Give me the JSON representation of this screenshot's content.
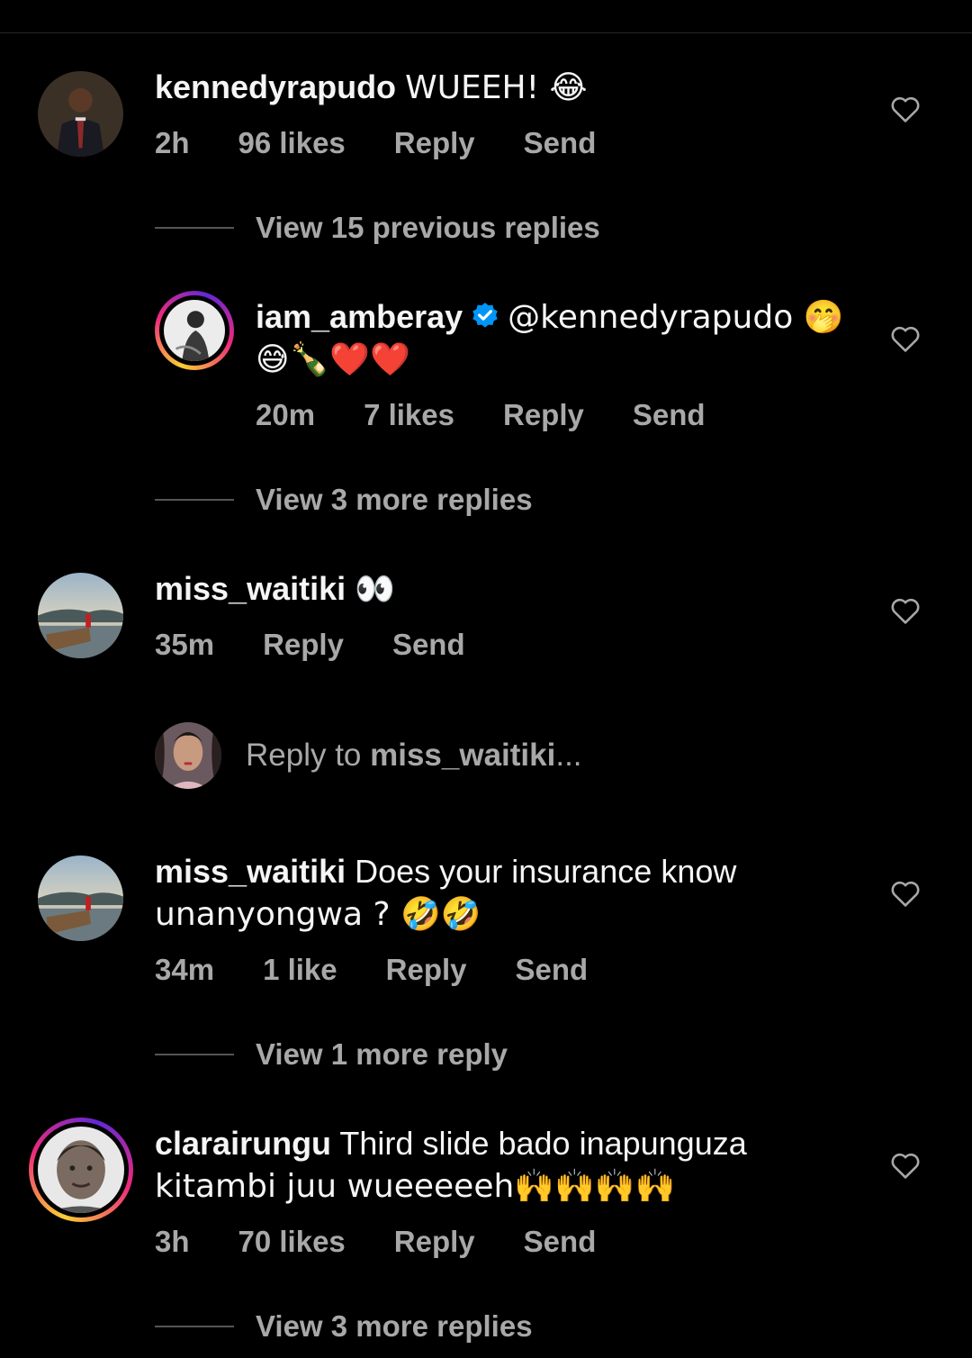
{
  "comments": [
    {
      "username": "kennedyrapudo",
      "text": "WUEEH! 😂",
      "time": "2h",
      "likes": "96 likes",
      "reply": "Reply",
      "send": "Send",
      "view_replies": "View 15 previous replies"
    },
    {
      "username": "iam_amberay",
      "text_line1": "@kennedyrapudo 🤭",
      "text_line2": "😅🍾❤️❤️",
      "time": "20m",
      "likes": "7 likes",
      "reply": "Reply",
      "send": "Send",
      "view_replies": "View 3 more replies"
    },
    {
      "username": "miss_waitiki",
      "text": "👀",
      "time": "35m",
      "reply": "Reply",
      "send": "Send"
    },
    {
      "username": "miss_waitiki",
      "text_line1": "Does your insurance know",
      "text_line2": "unanyongwa ? 🤣🤣",
      "time": "34m",
      "likes": "1 like",
      "reply": "Reply",
      "send": "Send",
      "view_replies": "View 1 more reply"
    },
    {
      "username": "clarairungu",
      "text_line1": "Third slide bado inapunguza",
      "text_line2": "kitambi juu wueeeeeh🙌🙌🙌🙌",
      "time": "3h",
      "likes": "70 likes",
      "reply": "Reply",
      "send": "Send",
      "view_replies": "View 3 more replies"
    }
  ],
  "reply_composer": {
    "prefix": "Reply to ",
    "target": "miss_waitiki",
    "suffix": "..."
  },
  "icons": {
    "heart": "heart-outline-icon",
    "verified": "verified-badge-icon"
  },
  "colors": {
    "background": "#000000",
    "text": "#f5f5f5",
    "secondary": "#a8a8a8",
    "verified": "#0095f6"
  }
}
